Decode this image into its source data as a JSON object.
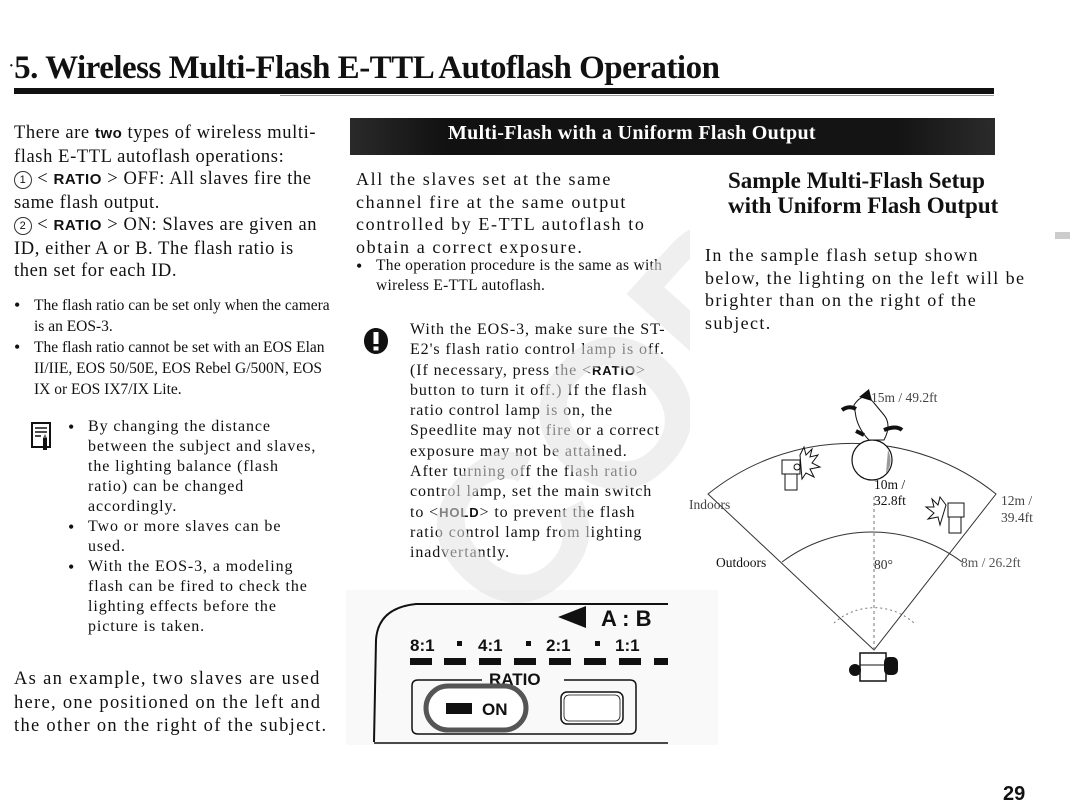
{
  "page": {
    "title_prefix": "·",
    "title": "5. Wireless Multi-Flash E-TTL Autoflash Operation",
    "page_number": "29"
  },
  "left_column": {
    "intro": {
      "text_before": "There are ",
      "bold_word": "two",
      "text_after": " types of wireless multi-flash E-TTL autoflash operations:"
    },
    "modes": [
      {
        "number": "1",
        "key": "RATIO",
        "text": "OFF: All slaves fire the same flash output."
      },
      {
        "number": "2",
        "key": "RATIO",
        "text": "ON: Slaves are given an ID, either A or B. The flash ratio is then set for each ID."
      }
    ],
    "bullets": [
      "The flash ratio can be set only when the camera is an EOS-3.",
      "The flash ratio cannot be set with an EOS Elan II/IIE, EOS 50/50E, EOS Rebel G/500N, EOS IX or EOS IX7/IX Lite."
    ],
    "note_icon": "memo-pencil-icon",
    "notes": [
      "By changing the distance between the subject and slaves, the lighting balance (flash ratio) can be changed accordingly.",
      "Two or more slaves can be used.",
      "With the EOS-3, a modeling flash can be fired to check the lighting effects before the picture is taken."
    ],
    "outro": "As an example, two slaves are used here, one positioned on the left and the other on the right of the subject."
  },
  "section": {
    "banner": "Multi-Flash with a Uniform Flash Output",
    "body": "All the slaves set at the same channel fire at the same output controlled by E-TTL autoflash to obtain a correct exposure.",
    "bullet": "The operation procedure is the same as with wireless E-TTL autoflash.",
    "caution_icon": "caution-icon",
    "caution": {
      "part1": "With the EOS-3, make sure the ST-E2's flash ratio control lamp is off. (If necessary, press the <",
      "key1": "RATIO",
      "part2": "> button to turn it off.) If the flash ratio control lamp is on, the Speedlite may not fire or a correct exposure may not be attained. After turning off the flash ratio control lamp, set the main switch to <",
      "key2": "HOLD",
      "part3": "> to prevent the flash ratio control lamp from lighting inadvertantly."
    }
  },
  "panel": {
    "ab_label": "A : B",
    "ratios": [
      "8:1",
      "4:1",
      "2:1",
      "1:1"
    ],
    "ratio_label": "RATIO",
    "on_label": "ON"
  },
  "sample": {
    "title": "Sample Multi-Flash Setup with Uniform Flash Output",
    "text": "In the sample flash setup shown below, the lighting on the left will be brighter than on the right of the subject."
  },
  "diagram": {
    "labels": {
      "indoors": "Indoors",
      "outdoors": "Outdoors",
      "indoor_far": "15m / 49.2ft",
      "indoor_side_1": "12m /",
      "indoor_side_2": "39.4ft",
      "outdoor_far_1": "10m /",
      "outdoor_far_2": "32.8ft",
      "outdoor_side": "8m / 26.2ft",
      "angle": "80°"
    }
  },
  "watermark": "COPY"
}
